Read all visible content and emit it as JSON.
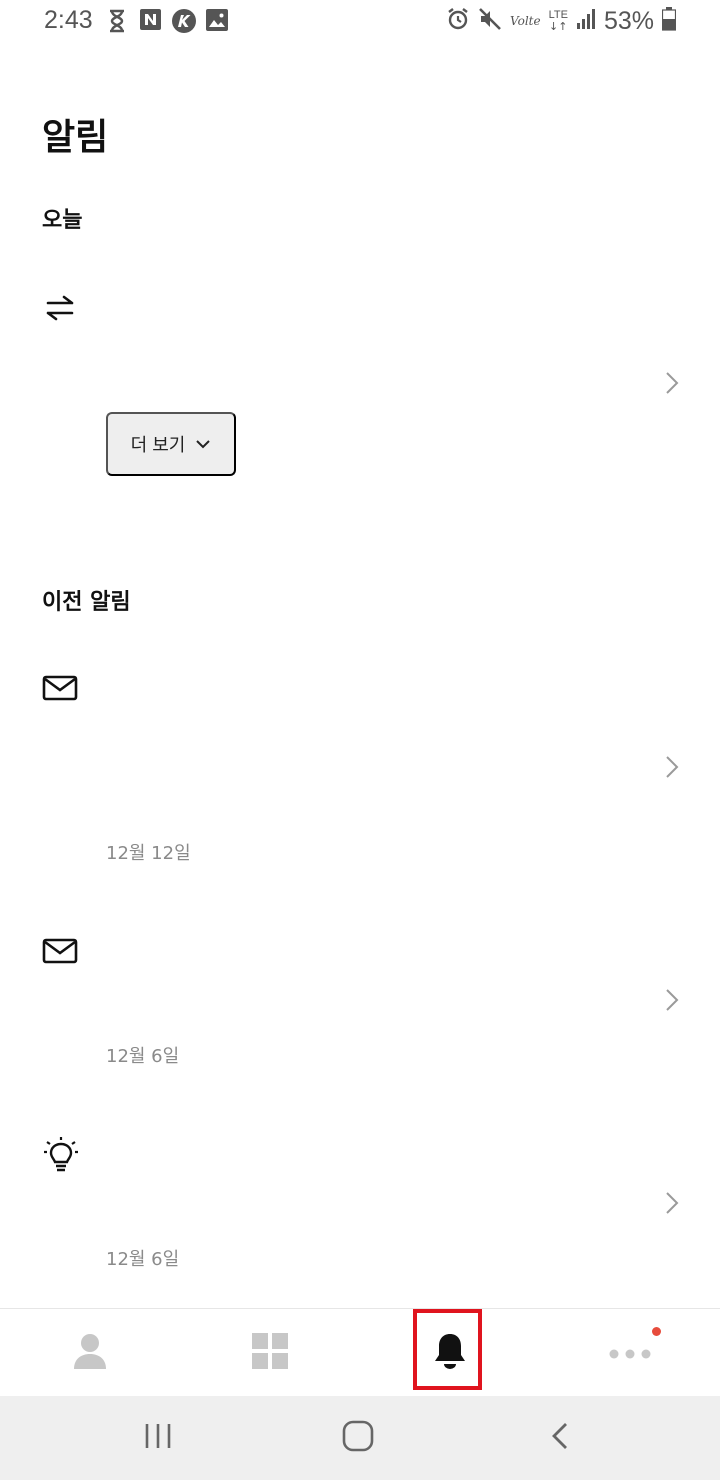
{
  "status_bar": {
    "time": "2:43",
    "network_label": "LTE",
    "volte_label": "Volte",
    "battery_percent": "53%",
    "icons": [
      "hourglass-icon",
      "naver-icon",
      "k-icon",
      "image-icon",
      "alarm-icon",
      "mute-icon",
      "signal-icon",
      "battery-icon"
    ]
  },
  "page": {
    "title": "알림"
  },
  "sections": {
    "today": {
      "title": "오늘",
      "item": {
        "icon": "transfer-arrows-icon",
        "more_button_label": "더 보기"
      }
    },
    "previous": {
      "title": "이전 알림",
      "items": [
        {
          "icon": "mail-icon",
          "date": "12월 12일"
        },
        {
          "icon": "mail-icon",
          "date": "12월 6일"
        },
        {
          "icon": "lightbulb-icon",
          "date": "12월 6일"
        }
      ]
    }
  },
  "bottom_nav": {
    "items": [
      {
        "icon": "person-icon",
        "active": false
      },
      {
        "icon": "grid-icon",
        "active": false
      },
      {
        "icon": "bell-icon",
        "active": true
      },
      {
        "icon": "more-dots-icon",
        "active": false,
        "badge": true
      }
    ]
  },
  "colors": {
    "highlight_border": "#e0141e",
    "badge": "#e74c3c",
    "inactive_icon": "#c7c7c7",
    "date_text": "#8a8a8a"
  }
}
